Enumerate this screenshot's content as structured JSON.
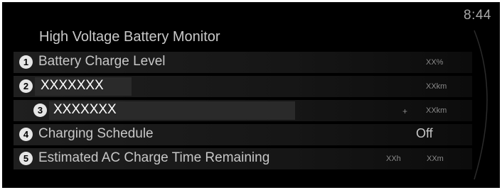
{
  "status_bar": {
    "time": "8:44"
  },
  "screen": {
    "title": "High Voltage Battery Monitor"
  },
  "rows": [
    {
      "number": "1",
      "label": "Battery Charge Level",
      "value": "XX%"
    },
    {
      "number": "2",
      "label": "XXXXXXX",
      "value": "XXkm"
    },
    {
      "number": "3",
      "label": "XXXXXXX",
      "prefix": "+",
      "value": "XXkm"
    },
    {
      "number": "4",
      "label": "Charging Schedule",
      "value": "Off"
    },
    {
      "number": "5",
      "label": "Estimated AC Charge Time Remaining",
      "hours": "XXh",
      "minutes": "XXm"
    }
  ]
}
